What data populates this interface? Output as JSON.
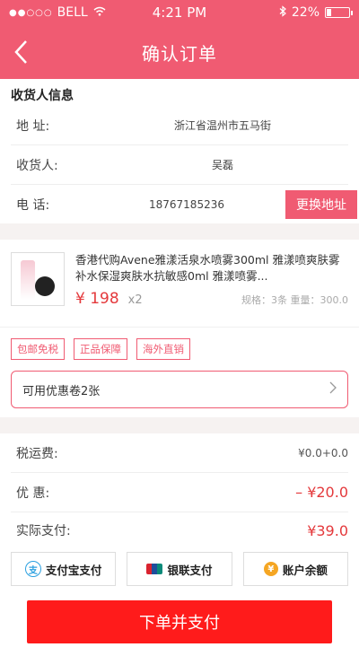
{
  "status_bar": {
    "signal_dots": "●●○○○",
    "carrier": "BELL",
    "time": "4:21 PM",
    "battery_percent_text": "22%",
    "battery_level": 0.22
  },
  "nav": {
    "title": "确认订单",
    "back_icon": "chevron-left-icon"
  },
  "address": {
    "section_title": "收货人信息",
    "address_label": "地    址:",
    "address_value": "浙江省温州市五马街",
    "receiver_label": "收货人:",
    "receiver_value": "吴磊",
    "phone_label": "电    话:",
    "phone_value": "18767185236",
    "change_button": "更换地址"
  },
  "product": {
    "name": "香港代购Avene雅漾活泉水喷雾300ml 雅漾喷爽肤雾补水保湿爽肤水抗敏感0ml 雅漾喷雾...",
    "price": "¥ 198",
    "quantity": "x2",
    "spec": "规格：3条    重量：300.0"
  },
  "tags": [
    "包邮免税",
    "正品保障",
    "海外直销"
  ],
  "coupon": {
    "label": "可用优惠卷2张",
    "chevron_icon": "chevron-right-icon"
  },
  "fees": {
    "tax_label": "税运费:",
    "tax_value": "¥0.0+0.0",
    "discount_label": "优    惠:",
    "discount_value": "– ¥20.0",
    "actual_label": "实际支付:",
    "actual_value": "¥39.0"
  },
  "payment": {
    "alipay": "支付宝支付",
    "unionpay": "银联支付",
    "balance": "账户余额"
  },
  "submit": {
    "label": "下单并支付"
  },
  "colors": {
    "brand": "#f05b72",
    "price_red": "#e4393c",
    "submit_red": "#ff1b1b"
  }
}
